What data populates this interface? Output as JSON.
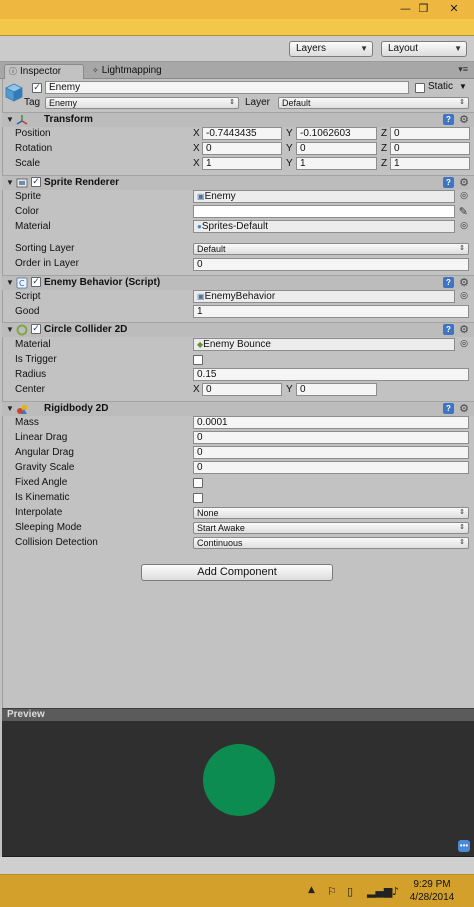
{
  "window": {
    "minimize_glyph": "—",
    "restore_glyph": "❐",
    "close_glyph": "✕"
  },
  "toolbar": {
    "layers": "Layers",
    "layout": "Layout"
  },
  "tabs": {
    "inspector": "Inspector",
    "lightmapping": "Lightmapping"
  },
  "object": {
    "name": "Enemy",
    "static_label": "Static",
    "tag_label": "Tag",
    "tag_value": "Enemy",
    "layer_label": "Layer",
    "layer_value": "Default"
  },
  "transform": {
    "title": "Transform",
    "position_label": "Position",
    "rotation_label": "Rotation",
    "scale_label": "Scale",
    "position": {
      "x": "-0.7443435",
      "y": "-0.1062603",
      "z": "0"
    },
    "rotation": {
      "x": "0",
      "y": "0",
      "z": "0"
    },
    "scale": {
      "x": "1",
      "y": "1",
      "z": "1"
    }
  },
  "axes": {
    "x": "X",
    "y": "Y",
    "z": "Z"
  },
  "sprite_renderer": {
    "title": "Sprite Renderer",
    "sprite_label": "Sprite",
    "sprite_value": "Enemy",
    "color_label": "Color",
    "color_value": "#ffffff",
    "material_label": "Material",
    "material_value": "Sprites-Default",
    "sorting_layer_label": "Sorting Layer",
    "sorting_layer_value": "Default",
    "order_label": "Order in Layer",
    "order_value": "0"
  },
  "enemy_behavior": {
    "title": "Enemy Behavior (Script)",
    "script_label": "Script",
    "script_value": "EnemyBehavior",
    "good_label": "Good",
    "good_value": "1"
  },
  "circle_collider": {
    "title": "Circle Collider 2D",
    "material_label": "Material",
    "material_value": "Enemy Bounce",
    "trigger_label": "Is Trigger",
    "radius_label": "Radius",
    "radius_value": "0.15",
    "center_label": "Center",
    "center": {
      "x": "0",
      "y": "0"
    }
  },
  "rigidbody": {
    "title": "Rigidbody 2D",
    "mass_label": "Mass",
    "mass_value": "0.0001",
    "linear_drag_label": "Linear Drag",
    "linear_drag_value": "0",
    "angular_drag_label": "Angular Drag",
    "angular_drag_value": "0",
    "gravity_label": "Gravity Scale",
    "gravity_value": "0",
    "fixed_angle_label": "Fixed Angle",
    "kinematic_label": "Is Kinematic",
    "interpolate_label": "Interpolate",
    "interpolate_value": "None",
    "sleeping_label": "Sleeping Mode",
    "sleeping_value": "Start Awake",
    "collision_label": "Collision Detection",
    "collision_value": "Continuous"
  },
  "add_component": "Add Component",
  "preview": {
    "label": "Preview",
    "circle_color": "#0d8c52"
  },
  "taskbar": {
    "time": "9:29 PM",
    "date": "4/28/2014"
  },
  "colors": {
    "title_bar": "#eeb73f",
    "taskbar": "#d3a02c",
    "help_icon": "#3f74c2"
  }
}
